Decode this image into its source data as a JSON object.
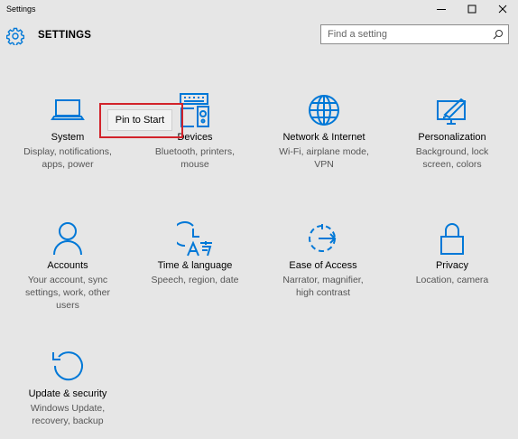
{
  "window": {
    "title": "Settings",
    "controls": {
      "minimize_icon": "minimize-icon",
      "maximize_icon": "maximize-icon",
      "close_icon": "close-icon"
    }
  },
  "header": {
    "icon": "gear-icon",
    "title": "SETTINGS"
  },
  "search": {
    "placeholder": "Find a setting",
    "value": "",
    "icon": "search-icon"
  },
  "accent_color": "#0078d7",
  "categories": [
    {
      "id": "system",
      "name": "System",
      "desc1": "Display, notifications,",
      "desc2": "apps, power",
      "desc3": "",
      "icon": "laptop-icon"
    },
    {
      "id": "devices",
      "name": "Devices",
      "desc1": "Bluetooth, printers,",
      "desc2": "mouse",
      "desc3": "",
      "icon": "devices-icon"
    },
    {
      "id": "network",
      "name": "Network & Internet",
      "desc1": "Wi-Fi, airplane mode,",
      "desc2": "VPN",
      "desc3": "",
      "icon": "globe-icon"
    },
    {
      "id": "personalization",
      "name": "Personalization",
      "desc1": "Background, lock",
      "desc2": "screen, colors",
      "desc3": "",
      "icon": "personalization-icon"
    },
    {
      "id": "accounts",
      "name": "Accounts",
      "desc1": "Your account, sync",
      "desc2": "settings, work, other",
      "desc3": "users",
      "icon": "person-icon"
    },
    {
      "id": "time",
      "name": "Time & language",
      "desc1": "Speech, region, date",
      "desc2": "",
      "desc3": "",
      "icon": "time-language-icon"
    },
    {
      "id": "ease",
      "name": "Ease of Access",
      "desc1": "Narrator, magnifier,",
      "desc2": "high contrast",
      "desc3": "",
      "icon": "ease-of-access-icon"
    },
    {
      "id": "privacy",
      "name": "Privacy",
      "desc1": "Location, camera",
      "desc2": "",
      "desc3": "",
      "icon": "lock-icon"
    },
    {
      "id": "update",
      "name": "Update & security",
      "desc1": "Windows Update,",
      "desc2": "recovery, backup",
      "desc3": "",
      "icon": "refresh-icon"
    }
  ],
  "context_menu": {
    "item_label": "Pin to Start"
  }
}
